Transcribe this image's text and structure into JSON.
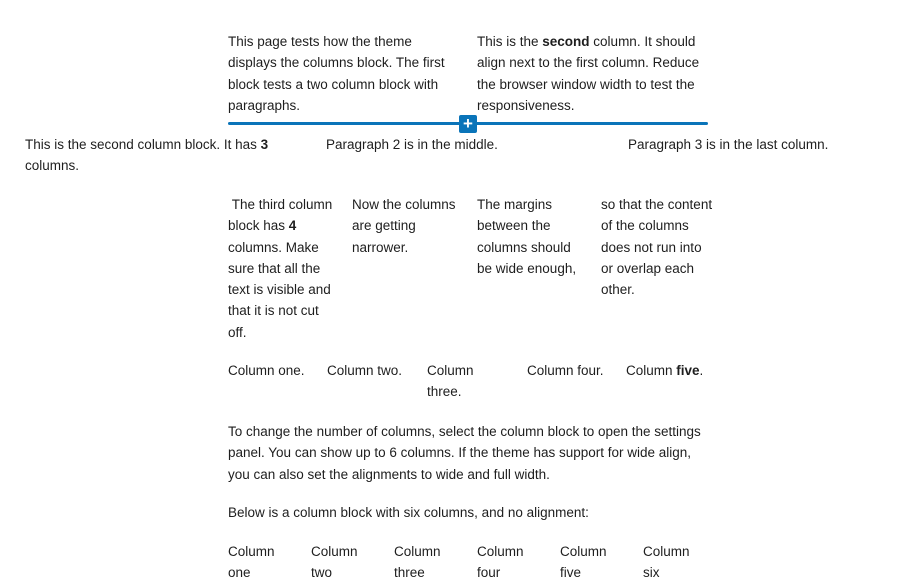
{
  "block_two_columns": {
    "col1": "This page tests how the theme displays the columns block. The first block tests a two column block with paragraphs.",
    "col2_pre": "This is the ",
    "col2_bold": "second",
    "col2_post": " column. It should align next to the first column. Reduce the browser window width to test the responsiveness."
  },
  "inserter": {
    "icon": "plus-icon",
    "glyph": "+",
    "color": "#0a74b9"
  },
  "block_three_columns": {
    "col1_pre": "This is the second column block. It has ",
    "col1_bold": "3",
    "col1_post": " columns.",
    "col2": "Paragraph 2 is in the middle.",
    "col3": "Paragraph 3 is in the last column."
  },
  "block_four_columns": {
    "col1_pre": " The third column block has ",
    "col1_bold": "4",
    "col1_post": " columns. Make sure that all the text is visible and that it is not cut off.",
    "col2": "Now the columns are getting narrower.",
    "col3": "The margins between the columns should be wide enough,",
    "col4": "so that the content of the columns does not run into or overlap each other."
  },
  "block_five_columns": {
    "col1": "Column one.",
    "col2": "Column two.",
    "col3": "Column three.",
    "col4": "Column four.",
    "col5_pre": "Column ",
    "col5_bold": "five",
    "col5_post": "."
  },
  "paragraphs": {
    "settings_info": "To change the number of columns, select the column block to open the settings panel. You can show up to 6 columns. If the theme has support for wide align, you can also set the alignments to wide and full width.",
    "six_intro": "Below is a column block with six columns, and no alignment:"
  },
  "block_six_columns": {
    "columns": [
      "Column one",
      "Column two",
      "Column three",
      "Column four",
      "Column five",
      "Column six"
    ]
  }
}
